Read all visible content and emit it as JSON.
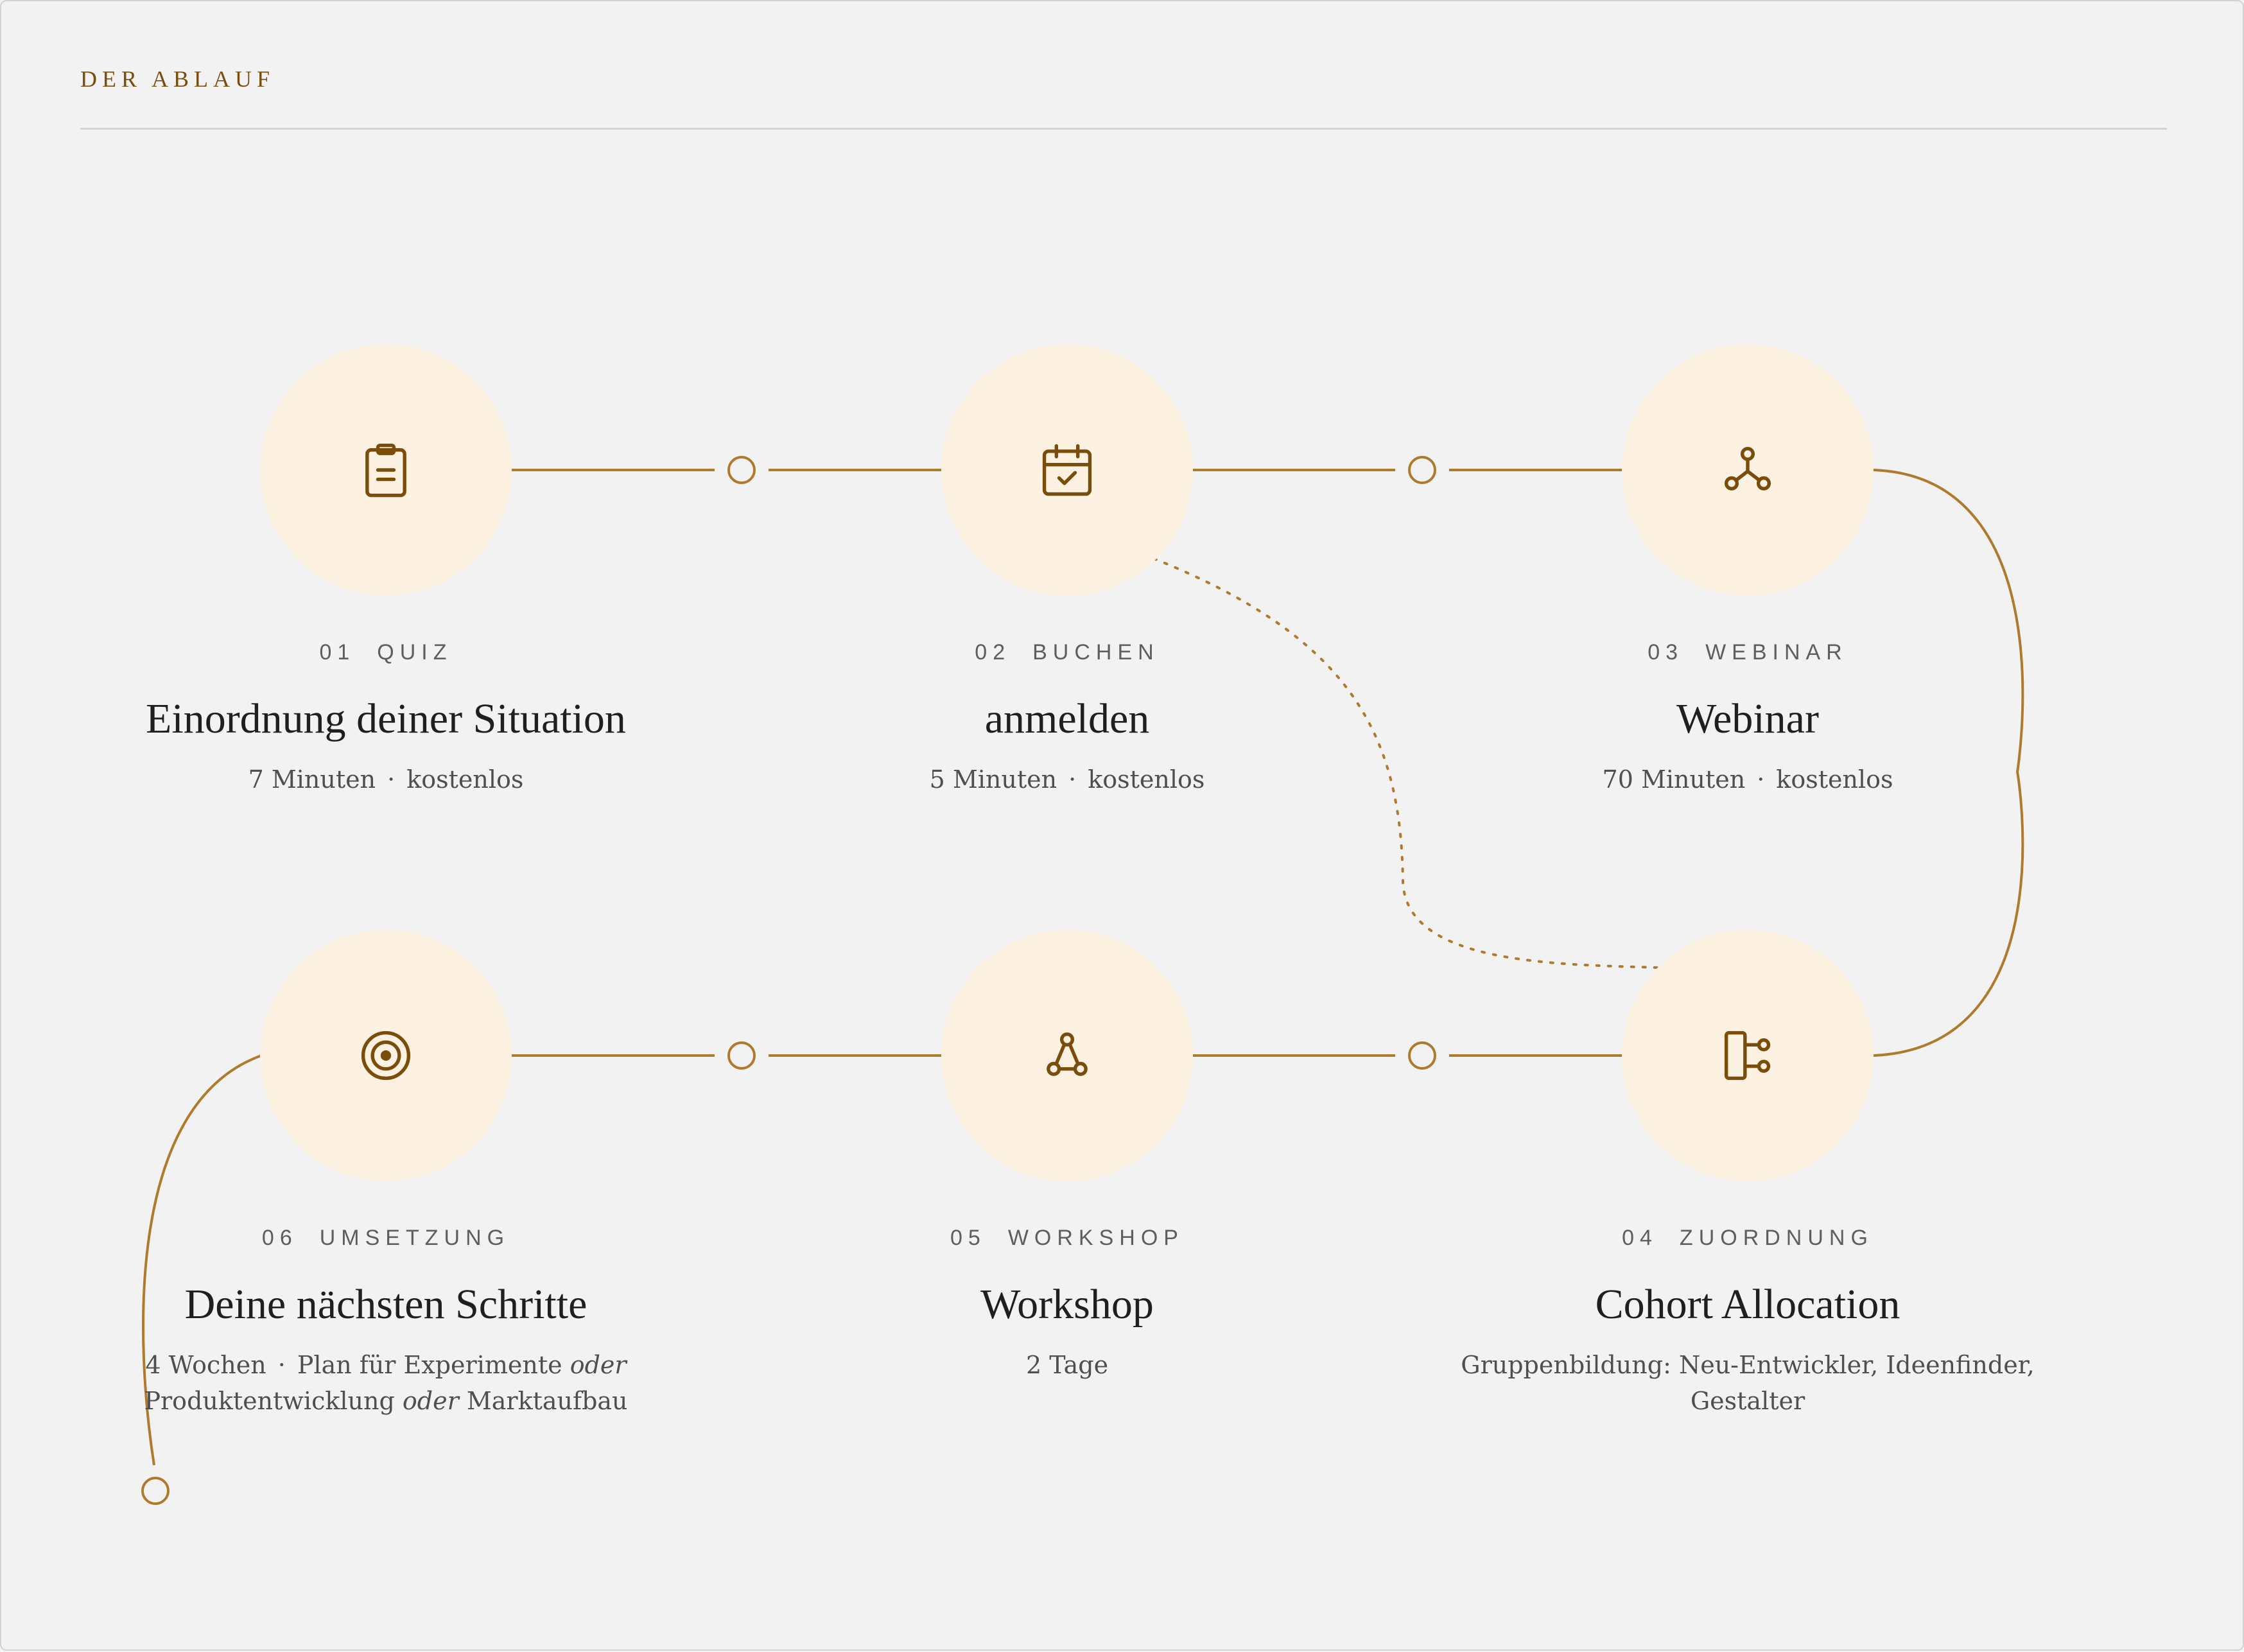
{
  "header": {
    "label": "DER ABLAUF"
  },
  "colors": {
    "background": "#f2f2f2",
    "node_fill": "#fdf2e1",
    "accent": "#7a4d0c",
    "connector": "#b07a2d"
  },
  "steps": [
    {
      "num": "01",
      "tag": "QUIZ",
      "title": "Einordnung deiner Situation",
      "meta": [
        "7 Minuten",
        "kostenlos"
      ],
      "icon": "clipboard-icon"
    },
    {
      "num": "02",
      "tag": "BUCHEN",
      "title": "anmelden",
      "meta": [
        "5 Minuten",
        "kostenlos"
      ],
      "icon": "calendar-check-icon"
    },
    {
      "num": "03",
      "tag": "WEBINAR",
      "title": "Webinar",
      "meta": [
        "70 Minuten",
        "kostenlos"
      ],
      "icon": "network-icon"
    },
    {
      "num": "04",
      "tag": "ZUORDNUNG",
      "title": "Cohort Allocation",
      "meta_line1": "Gruppenbildung: Neu-Entwickler, Ideenfinder,",
      "meta_line2": "Gestalter",
      "icon": "split-icon"
    },
    {
      "num": "05",
      "tag": "WORKSHOP",
      "title": "Workshop",
      "meta": [
        "2 Tage"
      ],
      "icon": "nodes-icon"
    },
    {
      "num": "06",
      "tag": "UMSETZUNG",
      "title": "Deine nächsten Schritte",
      "meta_l1_a": "4 Wochen",
      "meta_l1_b": "Plan für Experimente",
      "meta_or": "oder",
      "meta_l2_a": "Produktentwicklung",
      "meta_l2_b": "Marktaufbau",
      "icon": "target-icon"
    }
  ],
  "separator": "·"
}
